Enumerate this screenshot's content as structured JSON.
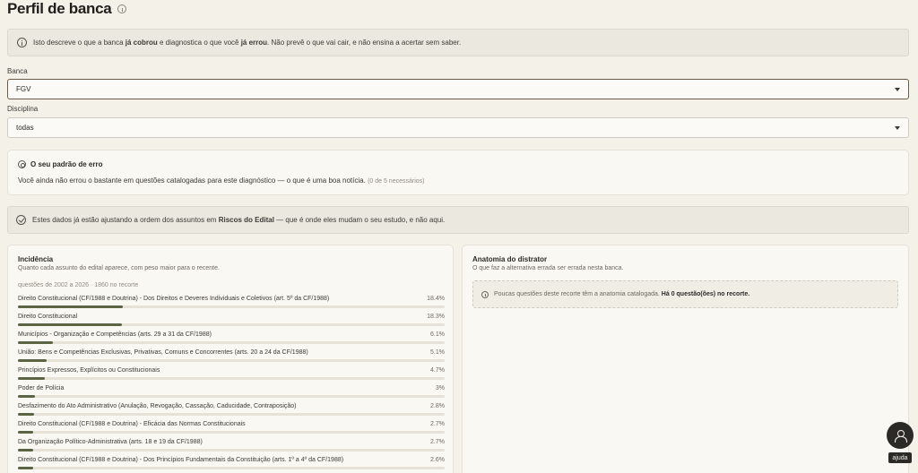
{
  "page": {
    "title": "Perfil de banca"
  },
  "intro_banner": {
    "text_1": "Isto descreve o que a banca ",
    "bold_1": "já cobrou",
    "text_2": " e diagnostica o que você ",
    "bold_2": "já errou",
    "text_3": ". Não prevê o que vai cair, e não ensina a acertar sem saber."
  },
  "filters": {
    "banca_label": "Banca",
    "banca_value": "FGV",
    "disciplina_label": "Disciplina",
    "disciplina_value": "todas"
  },
  "erro_card": {
    "title": "O seu padrão de erro",
    "text": "Você ainda não errou o bastante em questões catalogadas para este diagnóstico — o que é uma boa notícia.",
    "note": "(0 de 5 necessários)"
  },
  "ok_banner": {
    "text_1": "Estes dados já estão ajustando a ordem dos assuntos em ",
    "bold": "Riscos do Edital",
    "text_2": " — que é onde eles mudam o seu estudo, e não aqui."
  },
  "incidencia": {
    "title": "Incidência",
    "subtitle": "Quanto cada assunto do edital aparece, com peso maior para o recente.",
    "range": "questões de 2002 a 2026 · 1860 no recorte",
    "bar_color": "#5b6443",
    "rows": [
      {
        "name": "Direito Constitucional (CF/1988 e Doutrina) - Dos Direitos e Deveres Individuais e Coletivos (art. 5º da CF/1988)",
        "pct": "18.4%",
        "value": 18.4
      },
      {
        "name": "Direito Constitucional",
        "pct": "18.3%",
        "value": 18.3
      },
      {
        "name": "Municípios - Organização e Competências (arts. 29 a 31 da CF/1988)",
        "pct": "6.1%",
        "value": 6.1
      },
      {
        "name": "União: Bens e Competências Exclusivas, Privativas, Comuns e Concorrentes (arts. 20 a 24 da CF/1988)",
        "pct": "5.1%",
        "value": 5.1
      },
      {
        "name": "Princípios Expressos, Explícitos ou Constitucionais",
        "pct": "4.7%",
        "value": 4.7
      },
      {
        "name": "Poder de Polícia",
        "pct": "3%",
        "value": 3
      },
      {
        "name": "Desfazimento do Ato Administrativo (Anulação, Revogação, Cassação, Caducidade, Contraposição)",
        "pct": "2.8%",
        "value": 2.8
      },
      {
        "name": "Direito Constitucional (CF/1988 e Doutrina) - Eficácia das Normas Constitucionais",
        "pct": "2.7%",
        "value": 2.7
      },
      {
        "name": "Da Organização Político-Administrativa (arts. 18 e 19 da CF/1988)",
        "pct": "2.7%",
        "value": 2.7
      },
      {
        "name": "Direito Constitucional (CF/1988 e Doutrina) - Dos Princípios Fundamentais da Constituição (arts. 1º a 4º da CF/1988)",
        "pct": "2.6%",
        "value": 2.6
      }
    ]
  },
  "anatomia": {
    "title": "Anatomia do distrator",
    "subtitle": "O que faz a alternativa errada ser errada nesta banca.",
    "notice_text": "Poucas questões deste recorte têm a anatomia catalogada. ",
    "notice_bold": "Há 0 questão(ões) no recorte."
  },
  "help": {
    "label": "ajuda"
  }
}
